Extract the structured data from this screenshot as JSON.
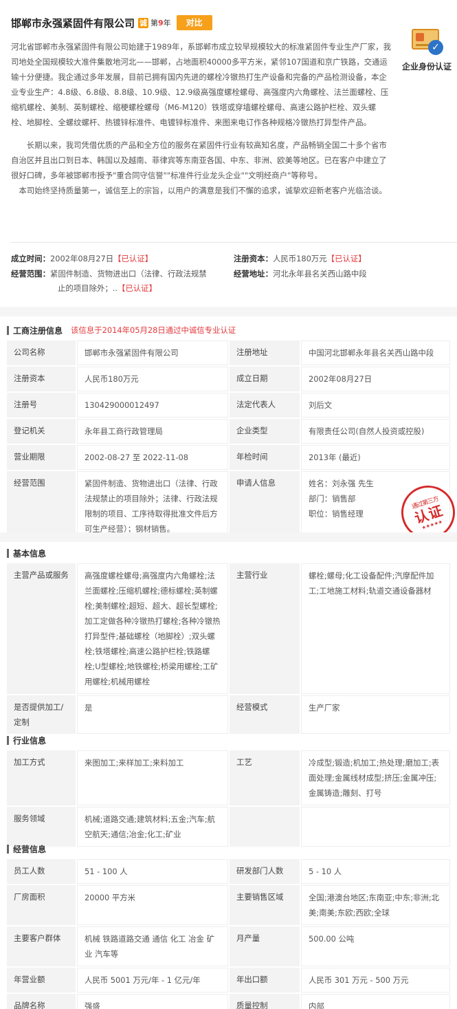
{
  "header": {
    "company_name": "邯郸市永强紧固件有限公司",
    "cheng_badge": "诚",
    "years_prefix": "第",
    "years_num": "9",
    "years_suffix": "年",
    "compare_label": "对比",
    "verify_label": "企业身份认证"
  },
  "intro": {
    "p1": "河北省邯郸市永强紧固件有限公司始建于1989年，系邯郸市成立较早规模较大的标准紧固件专业生产厂家，我司地处全国规模较大准件集散地河北——邯郸，占地面积40000多平方米，紧邻107国道和京广铁路，交通运输十分便捷。我企通过多年发展，目前已拥有国内先进的螺栓冷镦热打生产设备和完备的产品检测设备，本企业专业生产：4.8级、6.8级、8.8级、10.9级、12.9级高强度螺栓螺母、高强度内六角螺栓、法兰面螺栓、压缩机螺栓、美制、英制螺栓、缩梗螺栓螺母（M6-M120）铁塔或穿墙螺栓螺母、高速公路护栏栓、双头螺栓、地脚栓、全螺纹螺杆、热镀锌标准件、电镀锌标准件、来图来电订作各种规格冷镦热打异型件产品。",
    "p2": "长期以来，我司凭借优质的产品和全方位的服务在紧固件行业有较高知名度，产品畅销全国二十多个省市自治区并且出口到日本、韩国以及越南、菲律宾等东南亚各国、中东、非洲、欧美等地区。已在客户中建立了很好口碑，多年被邯郸市授予\"重合同守信誉\"\"标准件行业龙头企业\"\"文明经商户\"等称号。",
    "p3": "本司始终坚持质量第一，诚信至上的宗旨，以用户的满意是我们不懈的追求，诚挚欢迎新老客户光临洽谈。"
  },
  "facts": {
    "founded_label": "成立时间：",
    "founded_value": "2002年08月27日",
    "capital_label": "注册资本：",
    "capital_value": "人民币180万元",
    "scope_label": "经营范围：",
    "scope_value_1": "紧固件制造、货物进出口（法律、行政法规禁",
    "scope_value_2": "止的项目除外；..",
    "address_label": "经营地址：",
    "address_value": "河北永年县名关西山路中段",
    "cert_text": "已认证",
    "br_open": "【",
    "br_close": "】"
  },
  "registration": {
    "title": "工商注册信息",
    "note": "该信息于2014年05月28日通过中诚信专业认证",
    "rows": [
      [
        "公司名称",
        "邯郸市永强紧固件有限公司",
        "注册地址",
        "中国河北邯郸永年县名关西山路中段"
      ],
      [
        "注册资本",
        "人民币180万元",
        "成立日期",
        "2002年08月27日"
      ],
      [
        "注册号",
        "130429000012497",
        "法定代表人",
        "刘后文"
      ],
      [
        "登记机关",
        "永年县工商行政管理局",
        "企业类型",
        "有限责任公司(自然人投资或控股)"
      ],
      [
        "营业期限",
        "2002-08-27  至  2022-11-08",
        "年检时间",
        "2013年 (最近)"
      ]
    ],
    "scope_key": "经营范围",
    "scope_value": "紧固件制造、货物进出口（法律、行政法规禁止的项目除外；法律、行政法规限制的项目、工序待取得批准文件后方可生产经营）；钢材销售。",
    "applicant_key": "申请人信息",
    "applicant_name": "姓名：刘永强  先生",
    "applicant_dept": "部门：销售部",
    "applicant_title": "职位：销售经理",
    "stamp_small": "通过第三方",
    "stamp_big": "认证",
    "stamp_stars": "★★★★★"
  },
  "basic": {
    "title": "基本信息",
    "main_products_key": "主营产品或服务",
    "main_products_value": "高强度螺栓螺母;高强度内六角螺栓;法兰面螺栓;压缩机螺栓;德标螺栓;英制螺栓;美制螺栓;超短、超大、超长型螺栓;加工定做各种冷镦热打螺栓;各种冷镦热打异型件;基础螺栓（地脚栓）;双头螺栓;铁塔螺栓;高速公路护栏栓;铁路螺栓;U型螺栓;地铁螺栓;桥梁用螺栓;工矿用螺栓;机械用螺栓",
    "industry_key": "主营行业",
    "industry_value": "螺栓;螺母;化工设备配件;汽摩配件加工;工地施工材料;轨道交通设备器材",
    "oem_key": "是否提供加工/定制",
    "oem_value": "是",
    "mode_key": "经营模式",
    "mode_value": "生产厂家"
  },
  "industry": {
    "title": "行业信息",
    "process_key": "加工方式",
    "process_value": "来图加工;来样加工;来料加工",
    "craft_key": "工艺",
    "craft_value": "冷成型;锻造;机加工;热处理;磨加工;表面处理;金属线材成型;挤压;金属冲压;金属铸造;雕刻、打号",
    "service_key": "服务领域",
    "service_value": "机械;道路交通;建筑材料;五金;汽车;航空航天;通信;冶金;化工;矿业"
  },
  "operation": {
    "title": "经营信息",
    "rows": [
      [
        "员工人数",
        "51 - 100 人",
        "研发部门人数",
        "5 - 10 人"
      ],
      [
        "厂房面积",
        "20000 平方米",
        "主要销售区域",
        "全国;港澳台地区;东南亚;中东;非洲;北美;南美;东欧;西欧;全球"
      ],
      [
        "主要客户群体",
        "机械 铁路道路交通 通信 化工 冶金 矿业 汽车等",
        "月产量",
        "500.00 公吨"
      ],
      [
        "年营业额",
        "人民币 5001 万元/年 - 1 亿元/年",
        "年出口额",
        "人民币 301 万元 - 500 万元"
      ],
      [
        "品牌名称",
        "强盛",
        "质量控制",
        "内部"
      ]
    ]
  },
  "colors": {
    "accent_orange": "#f7a01b",
    "cert_red": "#e4393c",
    "link_blue": "#1c6fc2"
  }
}
